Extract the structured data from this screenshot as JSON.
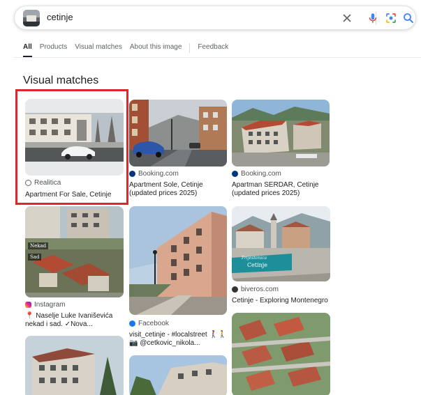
{
  "search": {
    "query": "cetinje"
  },
  "tabs": [
    {
      "label": "All",
      "active": true
    },
    {
      "label": "Products"
    },
    {
      "label": "Visual matches"
    },
    {
      "label": "About this image"
    },
    {
      "label": "Feedback"
    }
  ],
  "section_title": "Visual matches",
  "results": [
    {
      "source": "Realitica",
      "title": "Apartment For Sale, Cetinje",
      "icon": "globe-icon"
    },
    {
      "source": "Booking.com",
      "title": "Apartment Sole, Cetinje (updated prices 2025)",
      "icon": "booking-icon"
    },
    {
      "source": "Booking.com",
      "title": "Apartman SERDAR, Cetinje (updated prices 2025)",
      "icon": "booking-icon"
    },
    {
      "source": "Instagram",
      "title": "📍 Naselje Luke Ivaniševića nekad i sad. ✓Nova...",
      "icon": "instagram-icon",
      "overlay_top": "Nekad",
      "overlay_bottom": "Sad"
    },
    {
      "source": "Facebook",
      "title": "visit_cetinje - #localstreet 🚶‍♀️🚶 📷 @cetkovic_nikola...",
      "icon": "facebook-icon"
    },
    {
      "source": "biveros.com",
      "title": "Cetinje - Exploring Montenegro",
      "icon": "globe-icon",
      "sign_line1": "Prijestonica",
      "sign_line2": "Cetinje"
    }
  ],
  "colors": {
    "accent": "#1a73e8",
    "highlight": "#e0262c",
    "booking": "#003580",
    "facebook": "#1877f2"
  }
}
